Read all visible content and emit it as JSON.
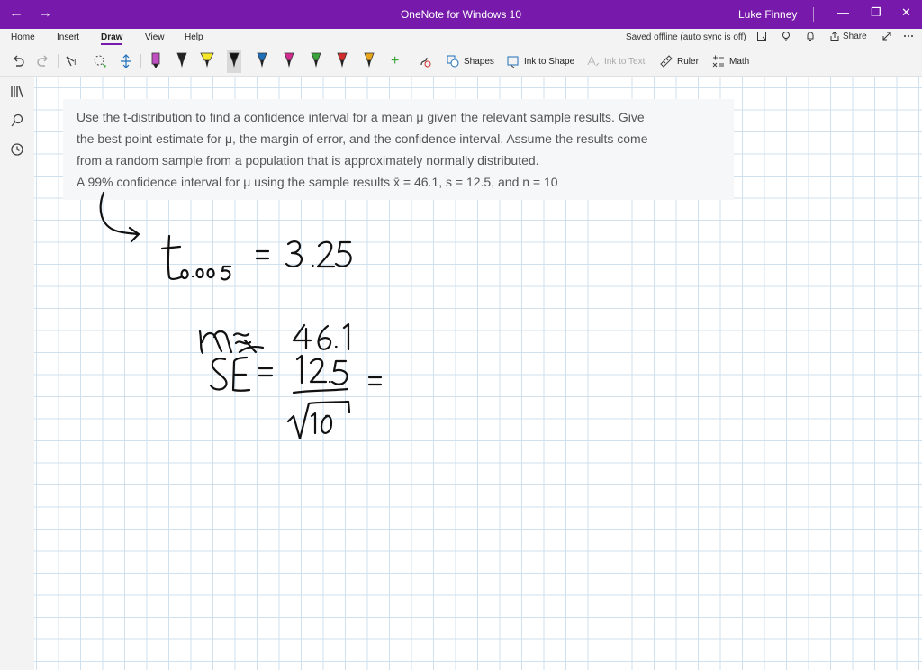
{
  "titlebar": {
    "back": "←",
    "forward": "→",
    "title": "OneNote for Windows 10",
    "user": "Luke Finney"
  },
  "window": {
    "minimize": "—",
    "restore": "❐",
    "close": "✕"
  },
  "menu": {
    "tabs": [
      "Home",
      "Insert",
      "Draw",
      "View",
      "Help"
    ],
    "active": "Draw",
    "status": "Saved offline (auto sync is off)",
    "share": "Share"
  },
  "toolbar": {
    "shapes": "Shapes",
    "ink_to_shape": "Ink to Shape",
    "ink_to_text": "Ink to Text",
    "ruler": "Ruler",
    "math": "Math",
    "pen_colors": [
      "#c04ec0",
      "#222222",
      "#f5e62c",
      "#111111",
      "#1f6fb8",
      "#d12c8e",
      "#3aa43a",
      "#d22b2b",
      "#e8a61b"
    ]
  },
  "question": {
    "line1": "Use the t-distribution to find a confidence interval for a mean μ given the relevant sample results. Give",
    "line2": "the best point estimate for μ, the margin of error, and the confidence interval. Assume the results come",
    "line3": "from a random sample from a population that is approximately normally distributed.",
    "line4": "A 99% confidence interval for μ using the sample results x̄ = 46.1, s = 12.5, and n = 10"
  },
  "handwriting": {
    "t_value": "t0.005 = 3.25",
    "mean_estimate": "μ ≈ 46.1",
    "standard_error": "SE = 12.5 / √10 ="
  }
}
